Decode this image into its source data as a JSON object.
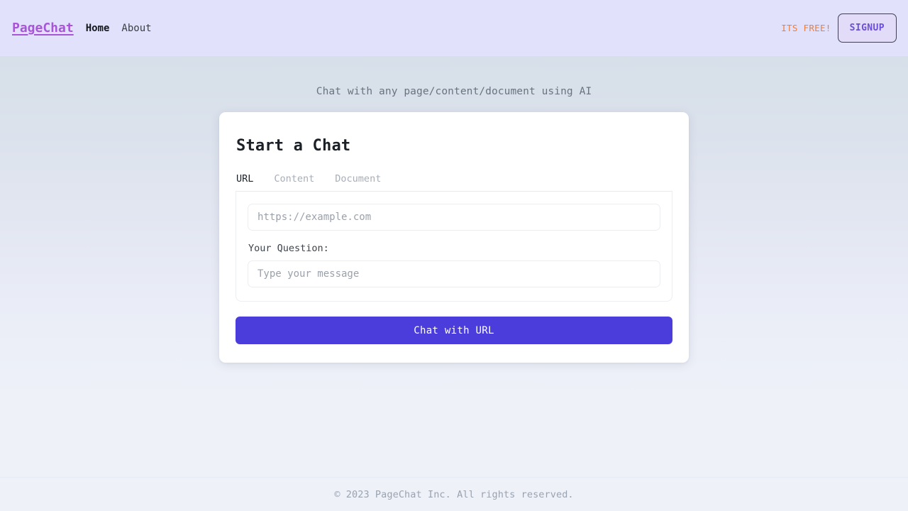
{
  "navbar": {
    "brand": "PageChat",
    "links": [
      {
        "label": "Home",
        "active": true
      },
      {
        "label": "About",
        "active": false
      }
    ],
    "free_tag": "ITS FREE!",
    "signup_label": "SIGNUP",
    "background": "#e1e1fb",
    "brand_color": "#a855d8",
    "free_tag_color": "#ed7e3b",
    "signup_text_color": "#6b4fd8"
  },
  "main": {
    "tagline": "Chat with any page/content/document using AI",
    "card": {
      "title": "Start a Chat",
      "tabs": [
        {
          "label": "URL",
          "active": true
        },
        {
          "label": "Content",
          "active": false
        },
        {
          "label": "Document",
          "active": false
        }
      ],
      "url_input": {
        "placeholder": "https://example.com",
        "value": ""
      },
      "question_label": "Your Question:",
      "message_input": {
        "placeholder": "Type your message",
        "value": ""
      },
      "submit_label": "Chat with URL",
      "submit_color": "#4a3ddb"
    }
  },
  "footer": {
    "copyright": "© 2023 PageChat Inc. All rights reserved."
  }
}
